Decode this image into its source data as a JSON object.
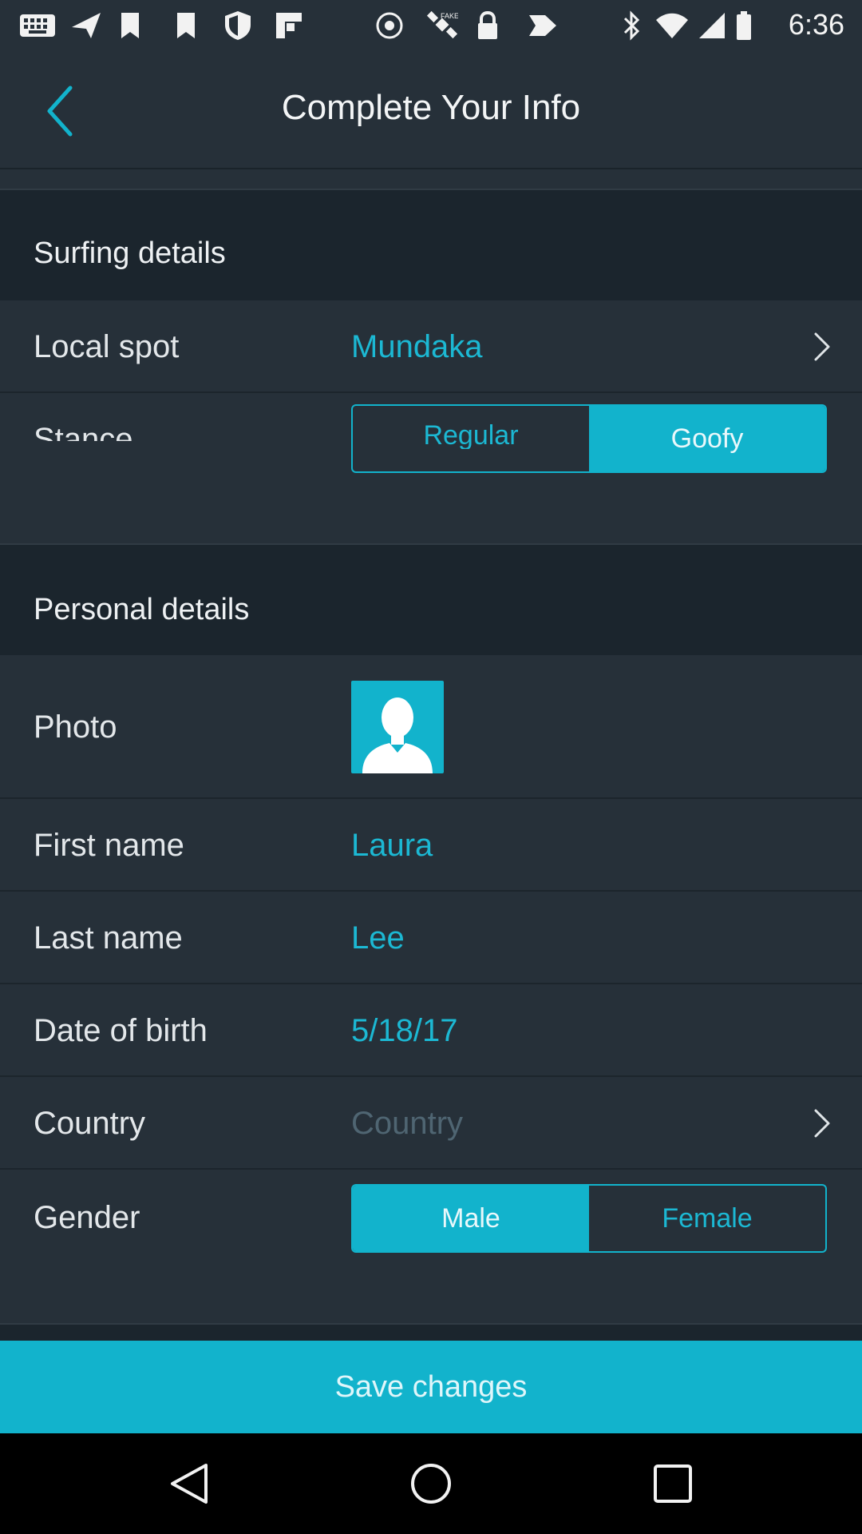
{
  "status_bar": {
    "time": "6:36",
    "icons": [
      "keyboard-icon",
      "send-icon",
      "bookmark-icon",
      "shield-icon",
      "flipboard-icon",
      "steam-icon",
      "satellite-icon",
      "lock-icon",
      "tag-icon",
      "bluetooth-icon",
      "wifi-icon",
      "signal-icon",
      "battery-icon"
    ]
  },
  "header": {
    "title": "Complete Your Info",
    "back_icon": "chevron-left-icon"
  },
  "surfing": {
    "section_title": "Surfing details",
    "local_spot": {
      "label": "Local spot",
      "value": "Mundaka"
    },
    "stance": {
      "label": "Stance",
      "options": [
        "Regular",
        "Goofy"
      ],
      "selected": "Goofy"
    }
  },
  "personal": {
    "section_title": "Personal details",
    "photo": {
      "label": "Photo",
      "icon": "default-avatar-icon"
    },
    "first_name": {
      "label": "First name",
      "value": "Laura"
    },
    "last_name": {
      "label": "Last name",
      "value": "Lee"
    },
    "dob": {
      "label": "Date of birth",
      "value": "5/18/17"
    },
    "country": {
      "label": "Country",
      "placeholder": "Country"
    },
    "gender": {
      "label": "Gender",
      "options": [
        "Male",
        "Female"
      ],
      "selected": "Male"
    }
  },
  "save": {
    "label": "Save changes"
  },
  "colors": {
    "accent": "#12b3cc",
    "panel": "#263039",
    "background": "#1b252d"
  }
}
